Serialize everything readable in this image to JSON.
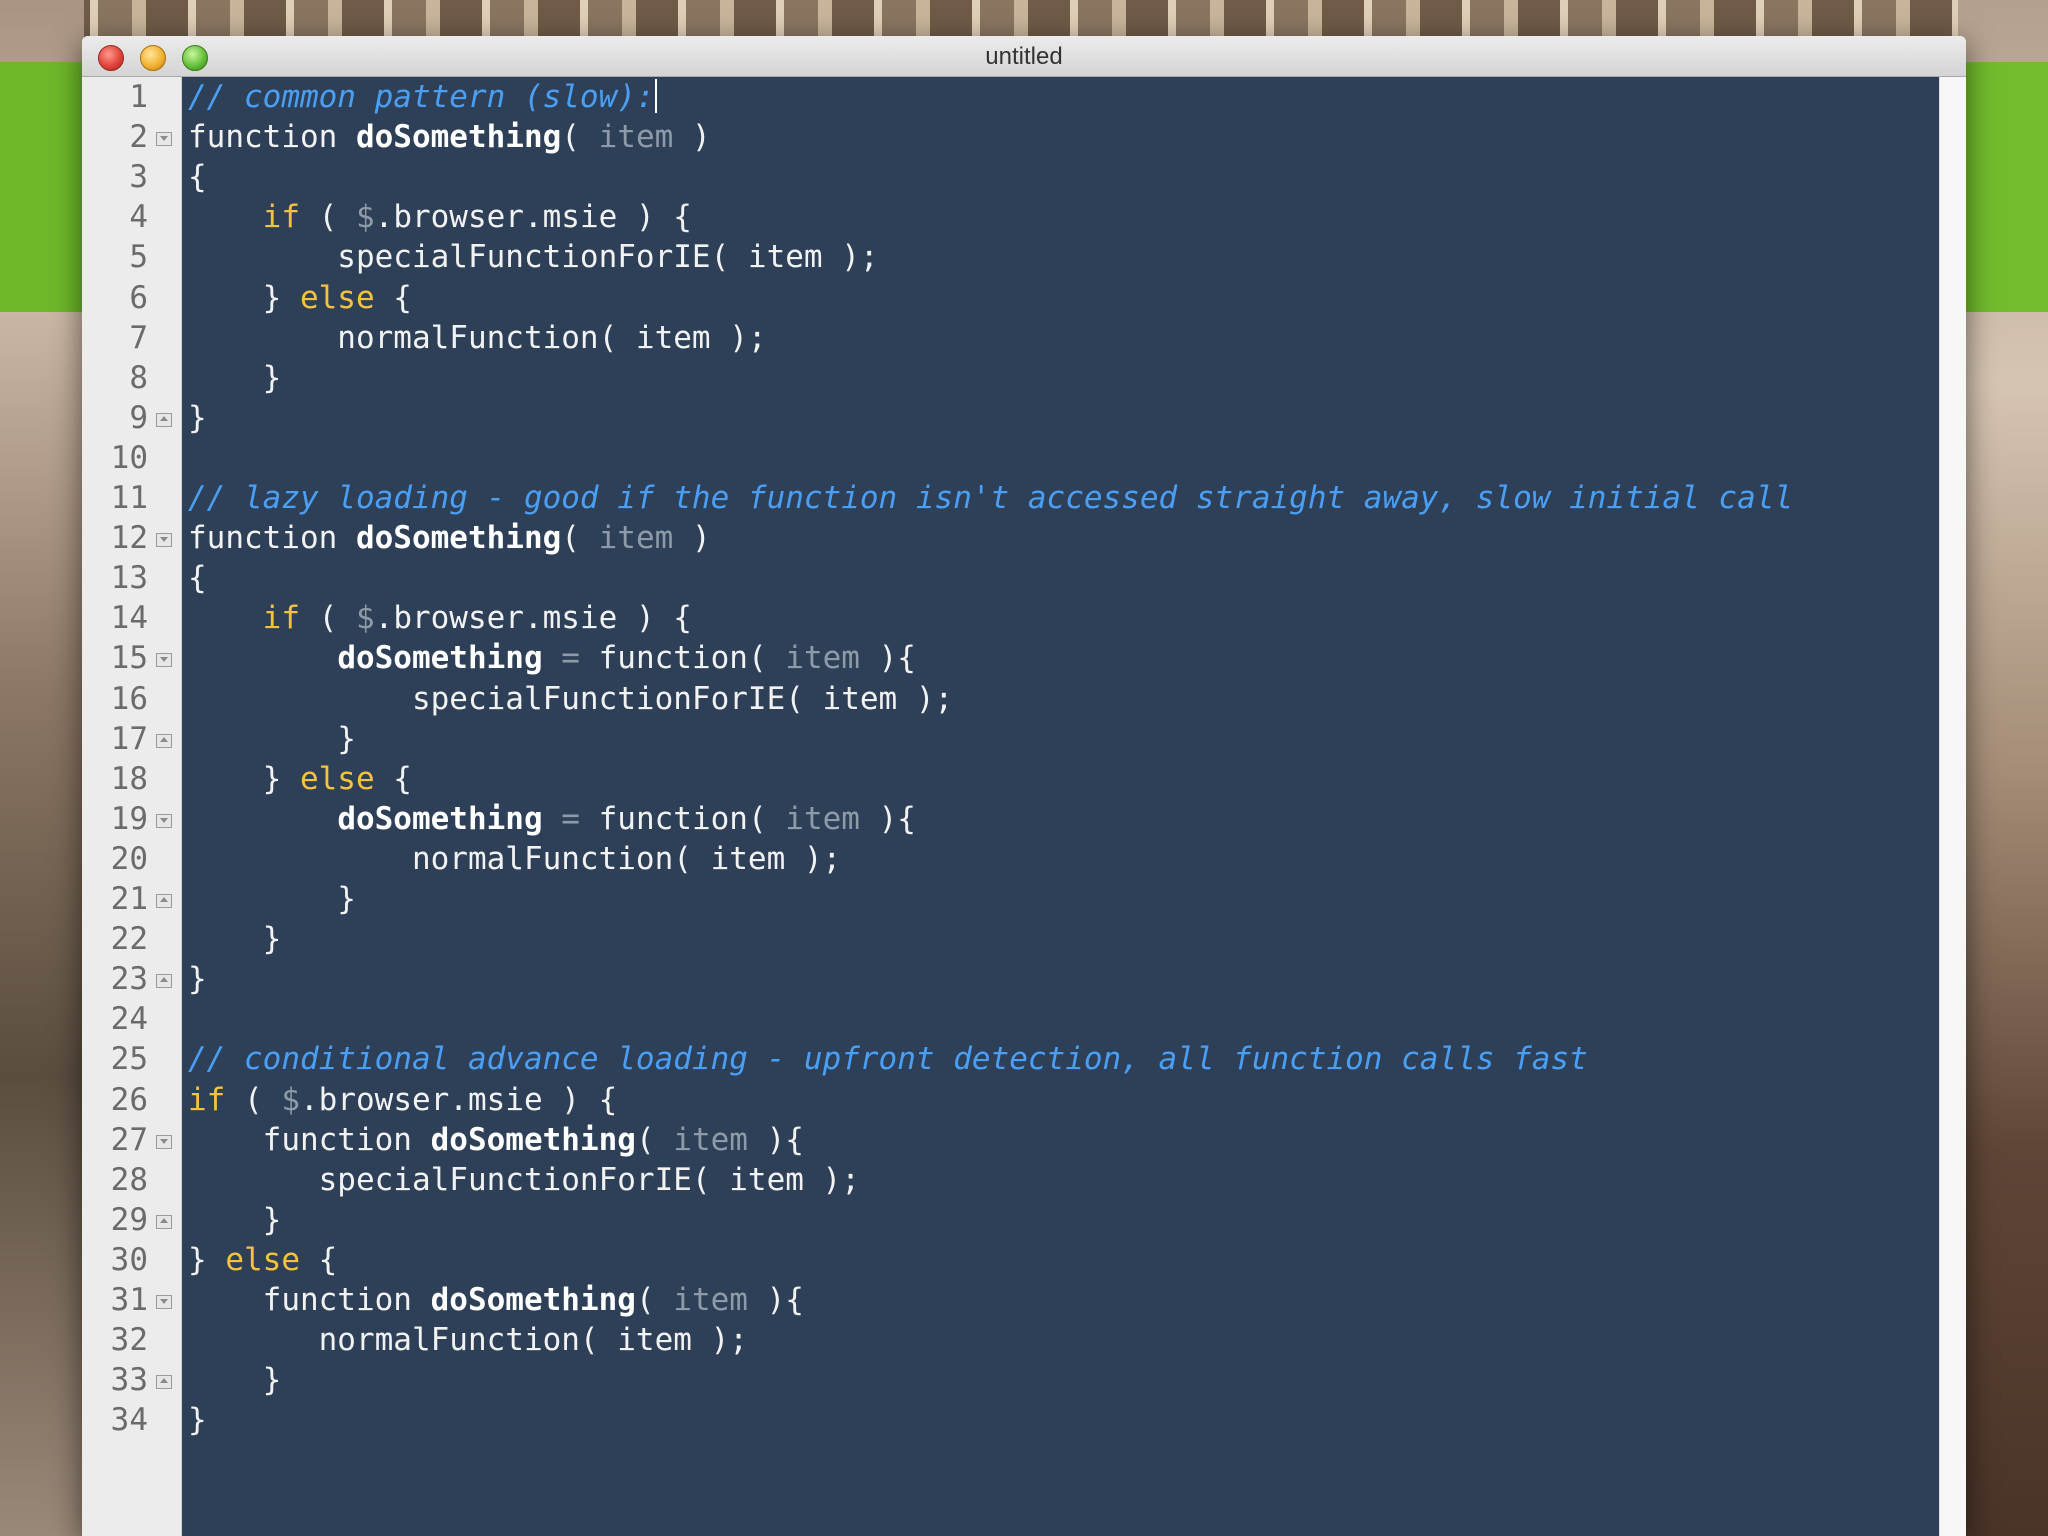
{
  "window": {
    "title": "untitled"
  },
  "colors": {
    "editor_bg": "#2e4057",
    "comment": "#4a9ff5",
    "keyword": "#f6c23e",
    "param": "#8e9aa8",
    "text": "#f2f2f2"
  },
  "icons": [
    "close-button",
    "minimize-button",
    "zoom-button",
    "fold-marker-icon"
  ],
  "editor": {
    "lines": [
      {
        "num": "1",
        "fold": "",
        "tokens": [
          {
            "t": "// common pattern (slow):",
            "c": "comment"
          },
          {
            "t": "",
            "c": "caret"
          }
        ]
      },
      {
        "num": "2",
        "fold": "start",
        "tokens": [
          {
            "t": "function ",
            "c": "plain"
          },
          {
            "t": "doSomething",
            "c": "entity"
          },
          {
            "t": "( ",
            "c": "plain"
          },
          {
            "t": "item",
            "c": "param"
          },
          {
            "t": " )",
            "c": "plain"
          }
        ]
      },
      {
        "num": "3",
        "fold": "",
        "tokens": [
          {
            "t": "{",
            "c": "plain"
          }
        ]
      },
      {
        "num": "4",
        "fold": "",
        "tokens": [
          {
            "t": "    ",
            "c": "plain"
          },
          {
            "t": "if",
            "c": "keyword"
          },
          {
            "t": " ( ",
            "c": "plain"
          },
          {
            "t": "$",
            "c": "dollar"
          },
          {
            "t": ".browser.msie ) {",
            "c": "plain"
          }
        ]
      },
      {
        "num": "5",
        "fold": "",
        "tokens": [
          {
            "t": "        specialFunctionForIE( item );",
            "c": "plain"
          }
        ]
      },
      {
        "num": "6",
        "fold": "",
        "tokens": [
          {
            "t": "    } ",
            "c": "plain"
          },
          {
            "t": "else",
            "c": "keyword"
          },
          {
            "t": " {",
            "c": "plain"
          }
        ]
      },
      {
        "num": "7",
        "fold": "",
        "tokens": [
          {
            "t": "        normalFunction( item );",
            "c": "plain"
          }
        ]
      },
      {
        "num": "8",
        "fold": "",
        "tokens": [
          {
            "t": "    }",
            "c": "plain"
          }
        ]
      },
      {
        "num": "9",
        "fold": "end",
        "tokens": [
          {
            "t": "}",
            "c": "plain"
          }
        ]
      },
      {
        "num": "10",
        "fold": "",
        "tokens": []
      },
      {
        "num": "11",
        "fold": "",
        "tokens": [
          {
            "t": "// lazy loading - good if the function isn't accessed straight away, slow initial call",
            "c": "comment"
          }
        ]
      },
      {
        "num": "12",
        "fold": "start",
        "tokens": [
          {
            "t": "function ",
            "c": "plain"
          },
          {
            "t": "doSomething",
            "c": "entity"
          },
          {
            "t": "( ",
            "c": "plain"
          },
          {
            "t": "item",
            "c": "param"
          },
          {
            "t": " )",
            "c": "plain"
          }
        ]
      },
      {
        "num": "13",
        "fold": "",
        "tokens": [
          {
            "t": "{",
            "c": "plain"
          }
        ]
      },
      {
        "num": "14",
        "fold": "",
        "tokens": [
          {
            "t": "    ",
            "c": "plain"
          },
          {
            "t": "if",
            "c": "keyword"
          },
          {
            "t": " ( ",
            "c": "plain"
          },
          {
            "t": "$",
            "c": "dollar"
          },
          {
            "t": ".browser.msie ) {",
            "c": "plain"
          }
        ]
      },
      {
        "num": "15",
        "fold": "start",
        "tokens": [
          {
            "t": "        ",
            "c": "plain"
          },
          {
            "t": "doSomething",
            "c": "entity"
          },
          {
            "t": " ",
            "c": "plain"
          },
          {
            "t": "=",
            "c": "op"
          },
          {
            "t": " function( ",
            "c": "plain"
          },
          {
            "t": "item",
            "c": "param"
          },
          {
            "t": " ){",
            "c": "plain"
          }
        ]
      },
      {
        "num": "16",
        "fold": "",
        "tokens": [
          {
            "t": "            specialFunctionForIE( item );",
            "c": "plain"
          }
        ]
      },
      {
        "num": "17",
        "fold": "end",
        "tokens": [
          {
            "t": "        }",
            "c": "plain"
          }
        ]
      },
      {
        "num": "18",
        "fold": "",
        "tokens": [
          {
            "t": "    } ",
            "c": "plain"
          },
          {
            "t": "else",
            "c": "keyword"
          },
          {
            "t": " {",
            "c": "plain"
          }
        ]
      },
      {
        "num": "19",
        "fold": "start",
        "tokens": [
          {
            "t": "        ",
            "c": "plain"
          },
          {
            "t": "doSomething",
            "c": "entity"
          },
          {
            "t": " ",
            "c": "plain"
          },
          {
            "t": "=",
            "c": "op"
          },
          {
            "t": " function( ",
            "c": "plain"
          },
          {
            "t": "item",
            "c": "param"
          },
          {
            "t": " ){",
            "c": "plain"
          }
        ]
      },
      {
        "num": "20",
        "fold": "",
        "tokens": [
          {
            "t": "            normalFunction( item );",
            "c": "plain"
          }
        ]
      },
      {
        "num": "21",
        "fold": "end",
        "tokens": [
          {
            "t": "        }",
            "c": "plain"
          }
        ]
      },
      {
        "num": "22",
        "fold": "",
        "tokens": [
          {
            "t": "    }",
            "c": "plain"
          }
        ]
      },
      {
        "num": "23",
        "fold": "end",
        "tokens": [
          {
            "t": "}",
            "c": "plain"
          }
        ]
      },
      {
        "num": "24",
        "fold": "",
        "tokens": []
      },
      {
        "num": "25",
        "fold": "",
        "tokens": [
          {
            "t": "// conditional advance loading - upfront detection, all function calls fast",
            "c": "comment"
          }
        ]
      },
      {
        "num": "26",
        "fold": "",
        "tokens": [
          {
            "t": "if",
            "c": "keyword"
          },
          {
            "t": " ( ",
            "c": "plain"
          },
          {
            "t": "$",
            "c": "dollar"
          },
          {
            "t": ".browser.msie ) {",
            "c": "plain"
          }
        ]
      },
      {
        "num": "27",
        "fold": "start",
        "tokens": [
          {
            "t": "    function ",
            "c": "plain"
          },
          {
            "t": "doSomething",
            "c": "entity"
          },
          {
            "t": "( ",
            "c": "plain"
          },
          {
            "t": "item",
            "c": "param"
          },
          {
            "t": " ){",
            "c": "plain"
          }
        ]
      },
      {
        "num": "28",
        "fold": "",
        "tokens": [
          {
            "t": "       specialFunctionForIE( item );",
            "c": "plain"
          }
        ]
      },
      {
        "num": "29",
        "fold": "end",
        "tokens": [
          {
            "t": "    }",
            "c": "plain"
          }
        ]
      },
      {
        "num": "30",
        "fold": "",
        "tokens": [
          {
            "t": "} ",
            "c": "plain"
          },
          {
            "t": "else",
            "c": "keyword"
          },
          {
            "t": " {",
            "c": "plain"
          }
        ]
      },
      {
        "num": "31",
        "fold": "start",
        "tokens": [
          {
            "t": "    function ",
            "c": "plain"
          },
          {
            "t": "doSomething",
            "c": "entity"
          },
          {
            "t": "( ",
            "c": "plain"
          },
          {
            "t": "item",
            "c": "param"
          },
          {
            "t": " ){",
            "c": "plain"
          }
        ]
      },
      {
        "num": "32",
        "fold": "",
        "tokens": [
          {
            "t": "       normalFunction( item );",
            "c": "plain"
          }
        ]
      },
      {
        "num": "33",
        "fold": "end",
        "tokens": [
          {
            "t": "    }",
            "c": "plain"
          }
        ]
      },
      {
        "num": "34",
        "fold": "",
        "tokens": [
          {
            "t": "}",
            "c": "plain"
          }
        ]
      }
    ]
  }
}
